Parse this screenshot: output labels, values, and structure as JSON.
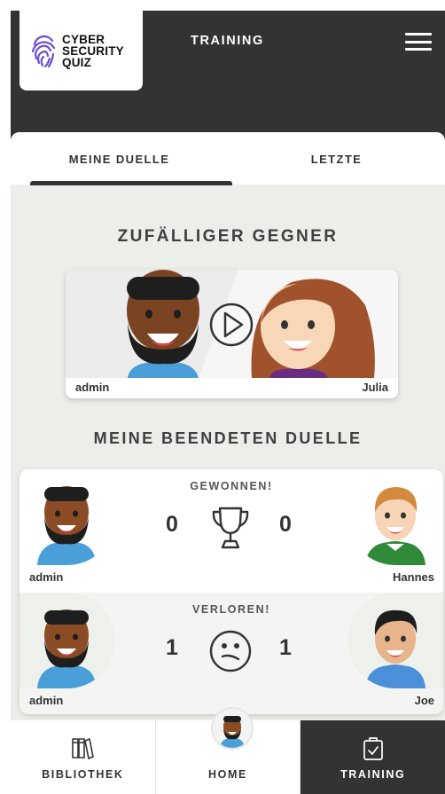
{
  "header": {
    "logo": {
      "line1": "CYBER",
      "line2": "SECURITY",
      "line3": "QUIZ"
    },
    "title": "TRAINING",
    "menu_icon": "hamburger-menu-icon"
  },
  "tabs": [
    {
      "label": "MEINE DUELLE",
      "active": true
    },
    {
      "label": "LETZTE",
      "active": false
    }
  ],
  "random_opponent": {
    "title": "ZUFÄLLIGER GEGNER",
    "left_player": "admin",
    "right_player": "Julia",
    "play_icon": "play-circle-icon"
  },
  "finished_duels": {
    "title": "MEINE BEENDETEN DUELLE",
    "duels": [
      {
        "result": "GEWONNEN!",
        "left_player": "admin",
        "right_player": "Hannes",
        "left_score": "0",
        "right_score": "0",
        "icon": "trophy-icon"
      },
      {
        "result": "VERLOREN!",
        "left_player": "admin",
        "right_player": "Joe",
        "left_score": "1",
        "right_score": "1",
        "icon": "confused-face-icon"
      }
    ]
  },
  "bottom_nav": [
    {
      "label": "BIBLIOTHEK",
      "icon": "books-icon",
      "active": false
    },
    {
      "label": "HOME",
      "icon": "avatar",
      "active": false
    },
    {
      "label": "TRAINING",
      "icon": "clipboard-check-icon",
      "active": true
    }
  ],
  "colors": {
    "dark": "#333333",
    "background": "#eceee9",
    "card": "#ffffff",
    "skin_dark": "#9a5a2e",
    "shirt_blue": "#4a9fd8",
    "shirt_green": "#2f8a3a",
    "hair_brown": "#a0522d"
  }
}
